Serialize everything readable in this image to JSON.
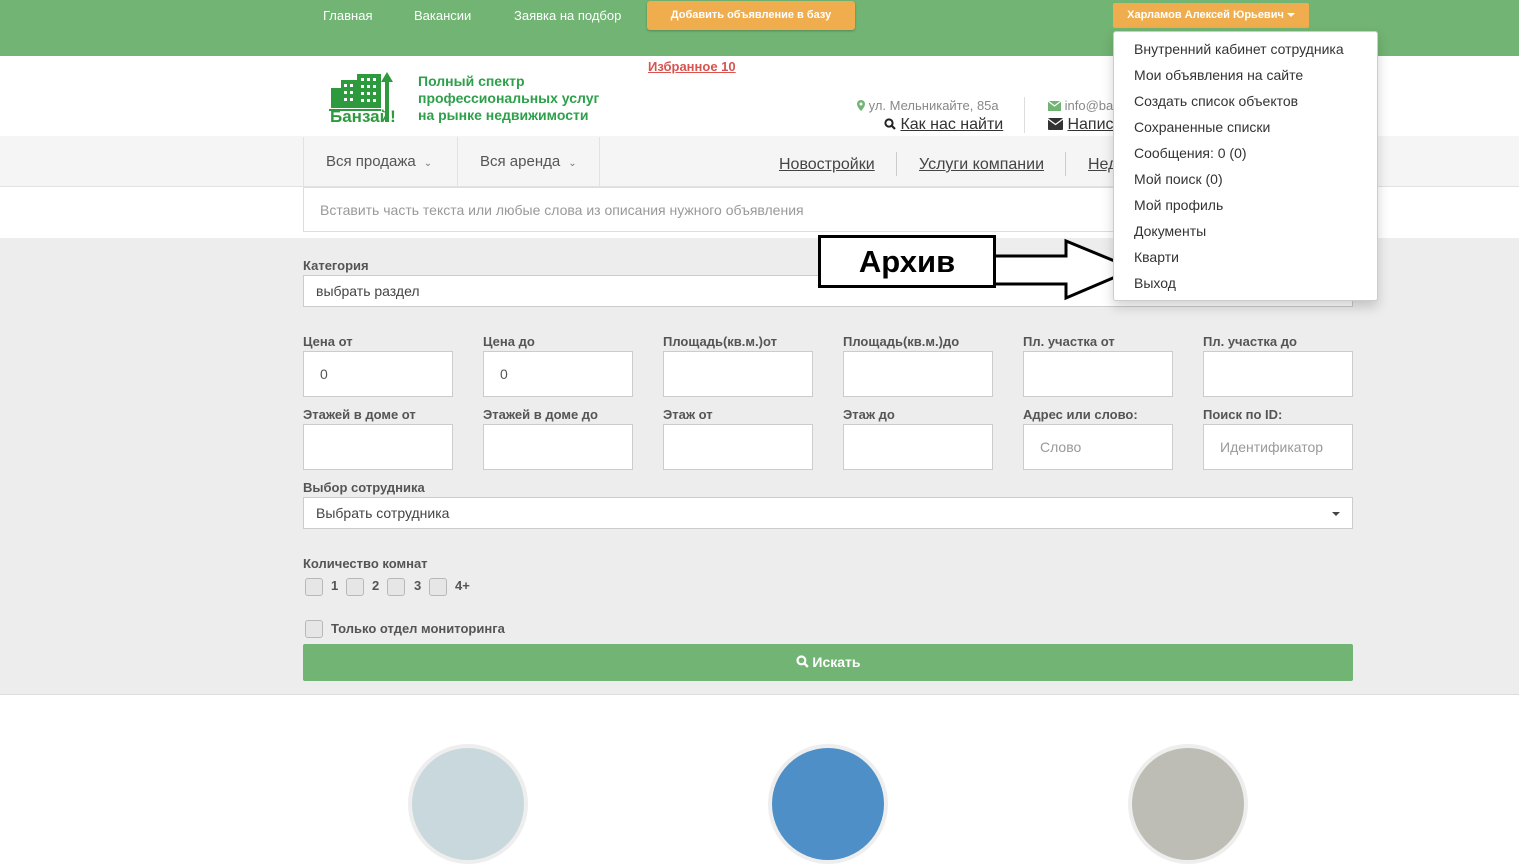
{
  "topnav": {
    "items": [
      "Главная",
      "Вакансии",
      "Заявка на подбор"
    ],
    "add_button": "Добавить объявление в базу",
    "user_button": "Харламов Алексей Юрьевич"
  },
  "header": {
    "logo_text": "Банзай!",
    "tagline_lines": [
      "Полный спектр",
      "профессиональных услуг",
      "на рынке недвижимости"
    ],
    "favorites": "Избранное 10",
    "address": "ул. Мельникайте, 85а",
    "find_us": "Как нас найти",
    "email": "info@ba",
    "write": "Напис"
  },
  "menubar": {
    "dropdowns": [
      "Вся продажа",
      "Вся аренда"
    ],
    "links": [
      "Новостройки",
      "Услуги компании",
      "Нед"
    ]
  },
  "search": {
    "placeholder": "Вставить часть текста или любые слова из описания нужного объявления"
  },
  "form": {
    "category_label": "Категория",
    "category_value": "выбрать раздел",
    "row1": [
      {
        "label": "Цена от",
        "value": "0"
      },
      {
        "label": "Цена до",
        "value": "0"
      },
      {
        "label": "Площадь(кв.м.)от",
        "value": ""
      },
      {
        "label": "Площадь(кв.м.)до",
        "value": ""
      },
      {
        "label": "Пл. участка от",
        "value": ""
      },
      {
        "label": "Пл. участка до",
        "value": ""
      }
    ],
    "row2": [
      {
        "label": "Этажей в доме от",
        "value": ""
      },
      {
        "label": "Этажей в доме до",
        "value": ""
      },
      {
        "label": "Этаж от",
        "value": ""
      },
      {
        "label": "Этаж до",
        "value": ""
      },
      {
        "label": "Адрес или слово:",
        "placeholder": "Слово"
      },
      {
        "label": "Поиск по ID:",
        "placeholder": "Идентификатор"
      }
    ],
    "employee_label": "Выбор сотрудника",
    "employee_value": "Выбрать сотрудника",
    "rooms_label": "Количество комнат",
    "rooms": [
      "1",
      "2",
      "3",
      "4+"
    ],
    "monitoring_label": "Только отдел мониторинга",
    "search_button": "Искать"
  },
  "user_menu": {
    "items": [
      "Внутренний кабинет сотрудника",
      "Мои объявления на сайте",
      "Создать список объектов",
      "Сохраненные списки",
      "Сообщения: 0 (0)",
      "Мой поиск (0)",
      "Мой профиль",
      "Документы",
      "Кварти",
      "Выход"
    ]
  },
  "annotation": {
    "label": "Архив"
  },
  "colors": {
    "green": "#72b474",
    "orange": "#f0ad4e",
    "favorites_red": "#d9534f"
  }
}
